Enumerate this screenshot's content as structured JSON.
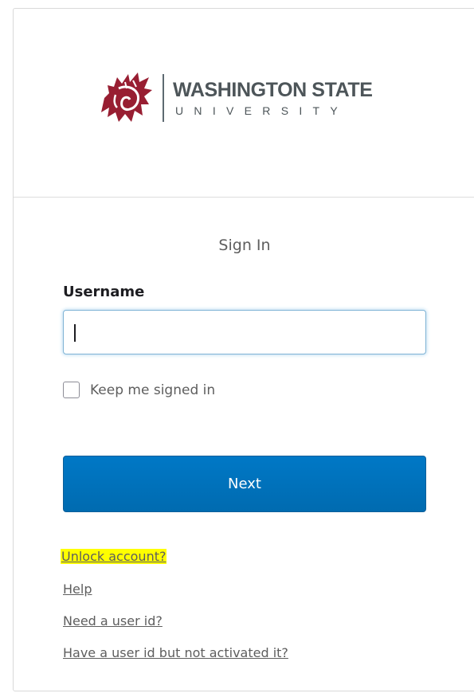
{
  "brand": {
    "name": "WASHINGTON STATE",
    "subname": "UNIVERSITY",
    "mark_icon": "wsu-cougar-head-logo",
    "color": "#981e32"
  },
  "form": {
    "title": "Sign In",
    "username_label": "Username",
    "username_value": "",
    "username_placeholder": "",
    "remember_label": "Keep me signed in",
    "remember_checked": false,
    "submit_label": "Next",
    "submit_color": "#0072bc"
  },
  "links": {
    "unlock": "Unlock account?",
    "help": "Help",
    "need_id": "Need a user id?",
    "activate": "Have a user id but not activated it?",
    "highlight_color": "#ffff00"
  }
}
